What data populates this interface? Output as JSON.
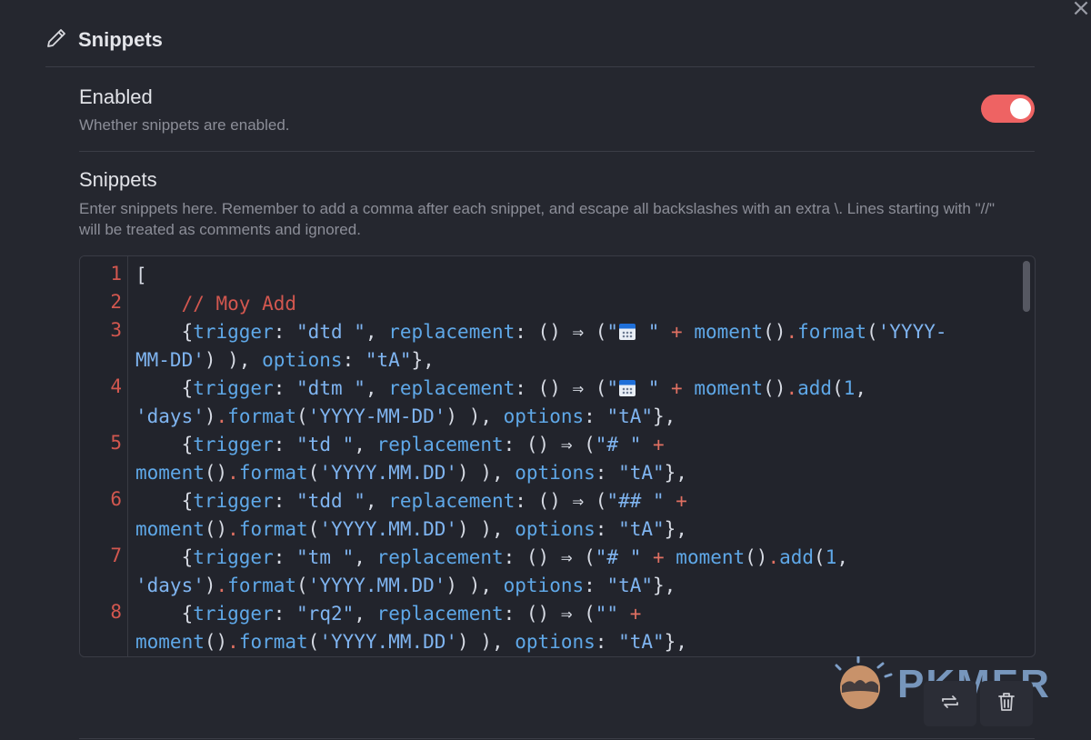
{
  "window": {
    "close_glyph": "×"
  },
  "section": {
    "title": "Snippets"
  },
  "enabled_setting": {
    "name": "Enabled",
    "description": "Whether snippets are enabled.",
    "toggle_on": true,
    "toggle_color": "#ee6363"
  },
  "snippets_setting": {
    "name": "Snippets",
    "description": "Enter snippets here. Remember to add a comma after each snippet, and escape all backslashes with an extra \\. Lines starting with \"//\" will be treated as comments and ignored."
  },
  "editor": {
    "line_numbers": [
      "1",
      "2",
      "3",
      "4",
      "5",
      "6",
      "7",
      "8"
    ],
    "lines": [
      [
        [
          "[",
          "text"
        ]
      ],
      [
        [
          "    // Moy Add",
          "comment"
        ]
      ],
      [
        [
          "    {",
          "text"
        ],
        [
          "trigger",
          "prop"
        ],
        [
          ": ",
          "text"
        ],
        [
          "\"dtd \"",
          "str"
        ],
        [
          ", ",
          "text"
        ],
        [
          "replacement",
          "prop"
        ],
        [
          ": () ⇒ (",
          "text"
        ],
        [
          "\"",
          "str"
        ],
        [
          "@cal",
          "icon"
        ],
        [
          " \"",
          "str"
        ],
        [
          " + ",
          "op"
        ],
        [
          "moment",
          "prop"
        ],
        [
          "()",
          "text"
        ],
        [
          ".",
          "op"
        ],
        [
          "format",
          "prop"
        ],
        [
          "(",
          "text"
        ],
        [
          "'YYYY-",
          "str"
        ]
      ],
      [
        [
          "MM-DD'",
          "str"
        ],
        [
          ") ), ",
          "text"
        ],
        [
          "options",
          "prop"
        ],
        [
          ": ",
          "text"
        ],
        [
          "\"tA\"",
          "str"
        ],
        [
          "},",
          "text"
        ]
      ],
      [
        [
          "    {",
          "text"
        ],
        [
          "trigger",
          "prop"
        ],
        [
          ": ",
          "text"
        ],
        [
          "\"dtm \"",
          "str"
        ],
        [
          ", ",
          "text"
        ],
        [
          "replacement",
          "prop"
        ],
        [
          ": () ⇒ (",
          "text"
        ],
        [
          "\"",
          "str"
        ],
        [
          "@cal",
          "icon"
        ],
        [
          " \"",
          "str"
        ],
        [
          " + ",
          "op"
        ],
        [
          "moment",
          "prop"
        ],
        [
          "()",
          "text"
        ],
        [
          ".",
          "op"
        ],
        [
          "add",
          "prop"
        ],
        [
          "(",
          "text"
        ],
        [
          "1",
          "num"
        ],
        [
          ",",
          "text"
        ]
      ],
      [
        [
          "'days'",
          "str"
        ],
        [
          ")",
          "text"
        ],
        [
          ".",
          "op"
        ],
        [
          "format",
          "prop"
        ],
        [
          "(",
          "text"
        ],
        [
          "'YYYY-MM-DD'",
          "str"
        ],
        [
          ") ), ",
          "text"
        ],
        [
          "options",
          "prop"
        ],
        [
          ": ",
          "text"
        ],
        [
          "\"tA\"",
          "str"
        ],
        [
          "},",
          "text"
        ]
      ],
      [
        [
          "    {",
          "text"
        ],
        [
          "trigger",
          "prop"
        ],
        [
          ": ",
          "text"
        ],
        [
          "\"td \"",
          "str"
        ],
        [
          ", ",
          "text"
        ],
        [
          "replacement",
          "prop"
        ],
        [
          ": () ⇒ (",
          "text"
        ],
        [
          "\"# \"",
          "str"
        ],
        [
          " +",
          "op"
        ]
      ],
      [
        [
          "moment",
          "prop"
        ],
        [
          "()",
          "text"
        ],
        [
          ".",
          "op"
        ],
        [
          "format",
          "prop"
        ],
        [
          "(",
          "text"
        ],
        [
          "'YYYY.MM.DD'",
          "str"
        ],
        [
          ") ), ",
          "text"
        ],
        [
          "options",
          "prop"
        ],
        [
          ": ",
          "text"
        ],
        [
          "\"tA\"",
          "str"
        ],
        [
          "},",
          "text"
        ]
      ],
      [
        [
          "    {",
          "text"
        ],
        [
          "trigger",
          "prop"
        ],
        [
          ": ",
          "text"
        ],
        [
          "\"tdd \"",
          "str"
        ],
        [
          ", ",
          "text"
        ],
        [
          "replacement",
          "prop"
        ],
        [
          ": () ⇒ (",
          "text"
        ],
        [
          "\"## \"",
          "str"
        ],
        [
          " +",
          "op"
        ]
      ],
      [
        [
          "moment",
          "prop"
        ],
        [
          "()",
          "text"
        ],
        [
          ".",
          "op"
        ],
        [
          "format",
          "prop"
        ],
        [
          "(",
          "text"
        ],
        [
          "'YYYY.MM.DD'",
          "str"
        ],
        [
          ") ), ",
          "text"
        ],
        [
          "options",
          "prop"
        ],
        [
          ": ",
          "text"
        ],
        [
          "\"tA\"",
          "str"
        ],
        [
          "},",
          "text"
        ]
      ],
      [
        [
          "    {",
          "text"
        ],
        [
          "trigger",
          "prop"
        ],
        [
          ": ",
          "text"
        ],
        [
          "\"tm \"",
          "str"
        ],
        [
          ", ",
          "text"
        ],
        [
          "replacement",
          "prop"
        ],
        [
          ": () ⇒ (",
          "text"
        ],
        [
          "\"# \"",
          "str"
        ],
        [
          " + ",
          "op"
        ],
        [
          "moment",
          "prop"
        ],
        [
          "()",
          "text"
        ],
        [
          ".",
          "op"
        ],
        [
          "add",
          "prop"
        ],
        [
          "(",
          "text"
        ],
        [
          "1",
          "num"
        ],
        [
          ",",
          "text"
        ]
      ],
      [
        [
          "'days'",
          "str"
        ],
        [
          ")",
          "text"
        ],
        [
          ".",
          "op"
        ],
        [
          "format",
          "prop"
        ],
        [
          "(",
          "text"
        ],
        [
          "'YYYY.MM.DD'",
          "str"
        ],
        [
          ") ), ",
          "text"
        ],
        [
          "options",
          "prop"
        ],
        [
          ": ",
          "text"
        ],
        [
          "\"tA\"",
          "str"
        ],
        [
          "},",
          "text"
        ]
      ],
      [
        [
          "    {",
          "text"
        ],
        [
          "trigger",
          "prop"
        ],
        [
          ": ",
          "text"
        ],
        [
          "\"rq2\"",
          "str"
        ],
        [
          ", ",
          "text"
        ],
        [
          "replacement",
          "prop"
        ],
        [
          ": () ⇒ (",
          "text"
        ],
        [
          "\"\"",
          "str"
        ],
        [
          " +",
          "op"
        ]
      ],
      [
        [
          "moment",
          "prop"
        ],
        [
          "()",
          "text"
        ],
        [
          ".",
          "op"
        ],
        [
          "format",
          "prop"
        ],
        [
          "(",
          "text"
        ],
        [
          "'YYYY.MM.DD'",
          "str"
        ],
        [
          ") ), ",
          "text"
        ],
        [
          "options",
          "prop"
        ],
        [
          ": ",
          "text"
        ],
        [
          "\"tA\"",
          "str"
        ],
        [
          "},",
          "text"
        ]
      ]
    ]
  },
  "actions": {
    "swap_icon": "swap-icon",
    "trash_icon": "trash-icon"
  },
  "watermark": {
    "text": "PKMER"
  }
}
